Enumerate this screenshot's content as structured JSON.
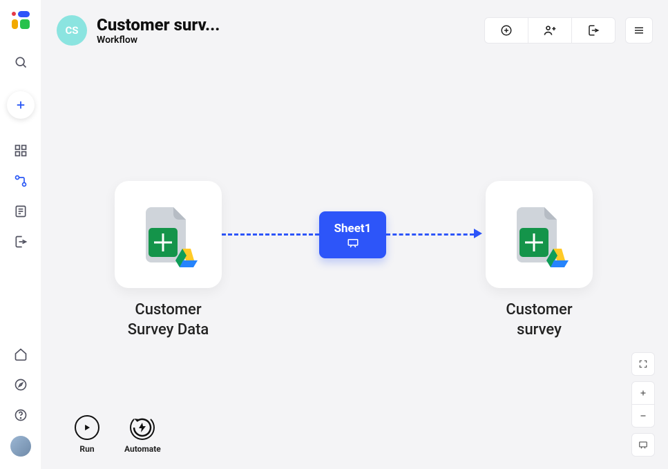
{
  "header": {
    "avatar_initials": "CS",
    "title": "Customer surv...",
    "subtitle": "Workflow"
  },
  "nodes": {
    "source": {
      "label": "Customer Survey Data"
    },
    "dest": {
      "label": "Customer survey"
    }
  },
  "connector": {
    "label": "Sheet1"
  },
  "footer": {
    "run_label": "Run",
    "automate_label": "Automate"
  }
}
